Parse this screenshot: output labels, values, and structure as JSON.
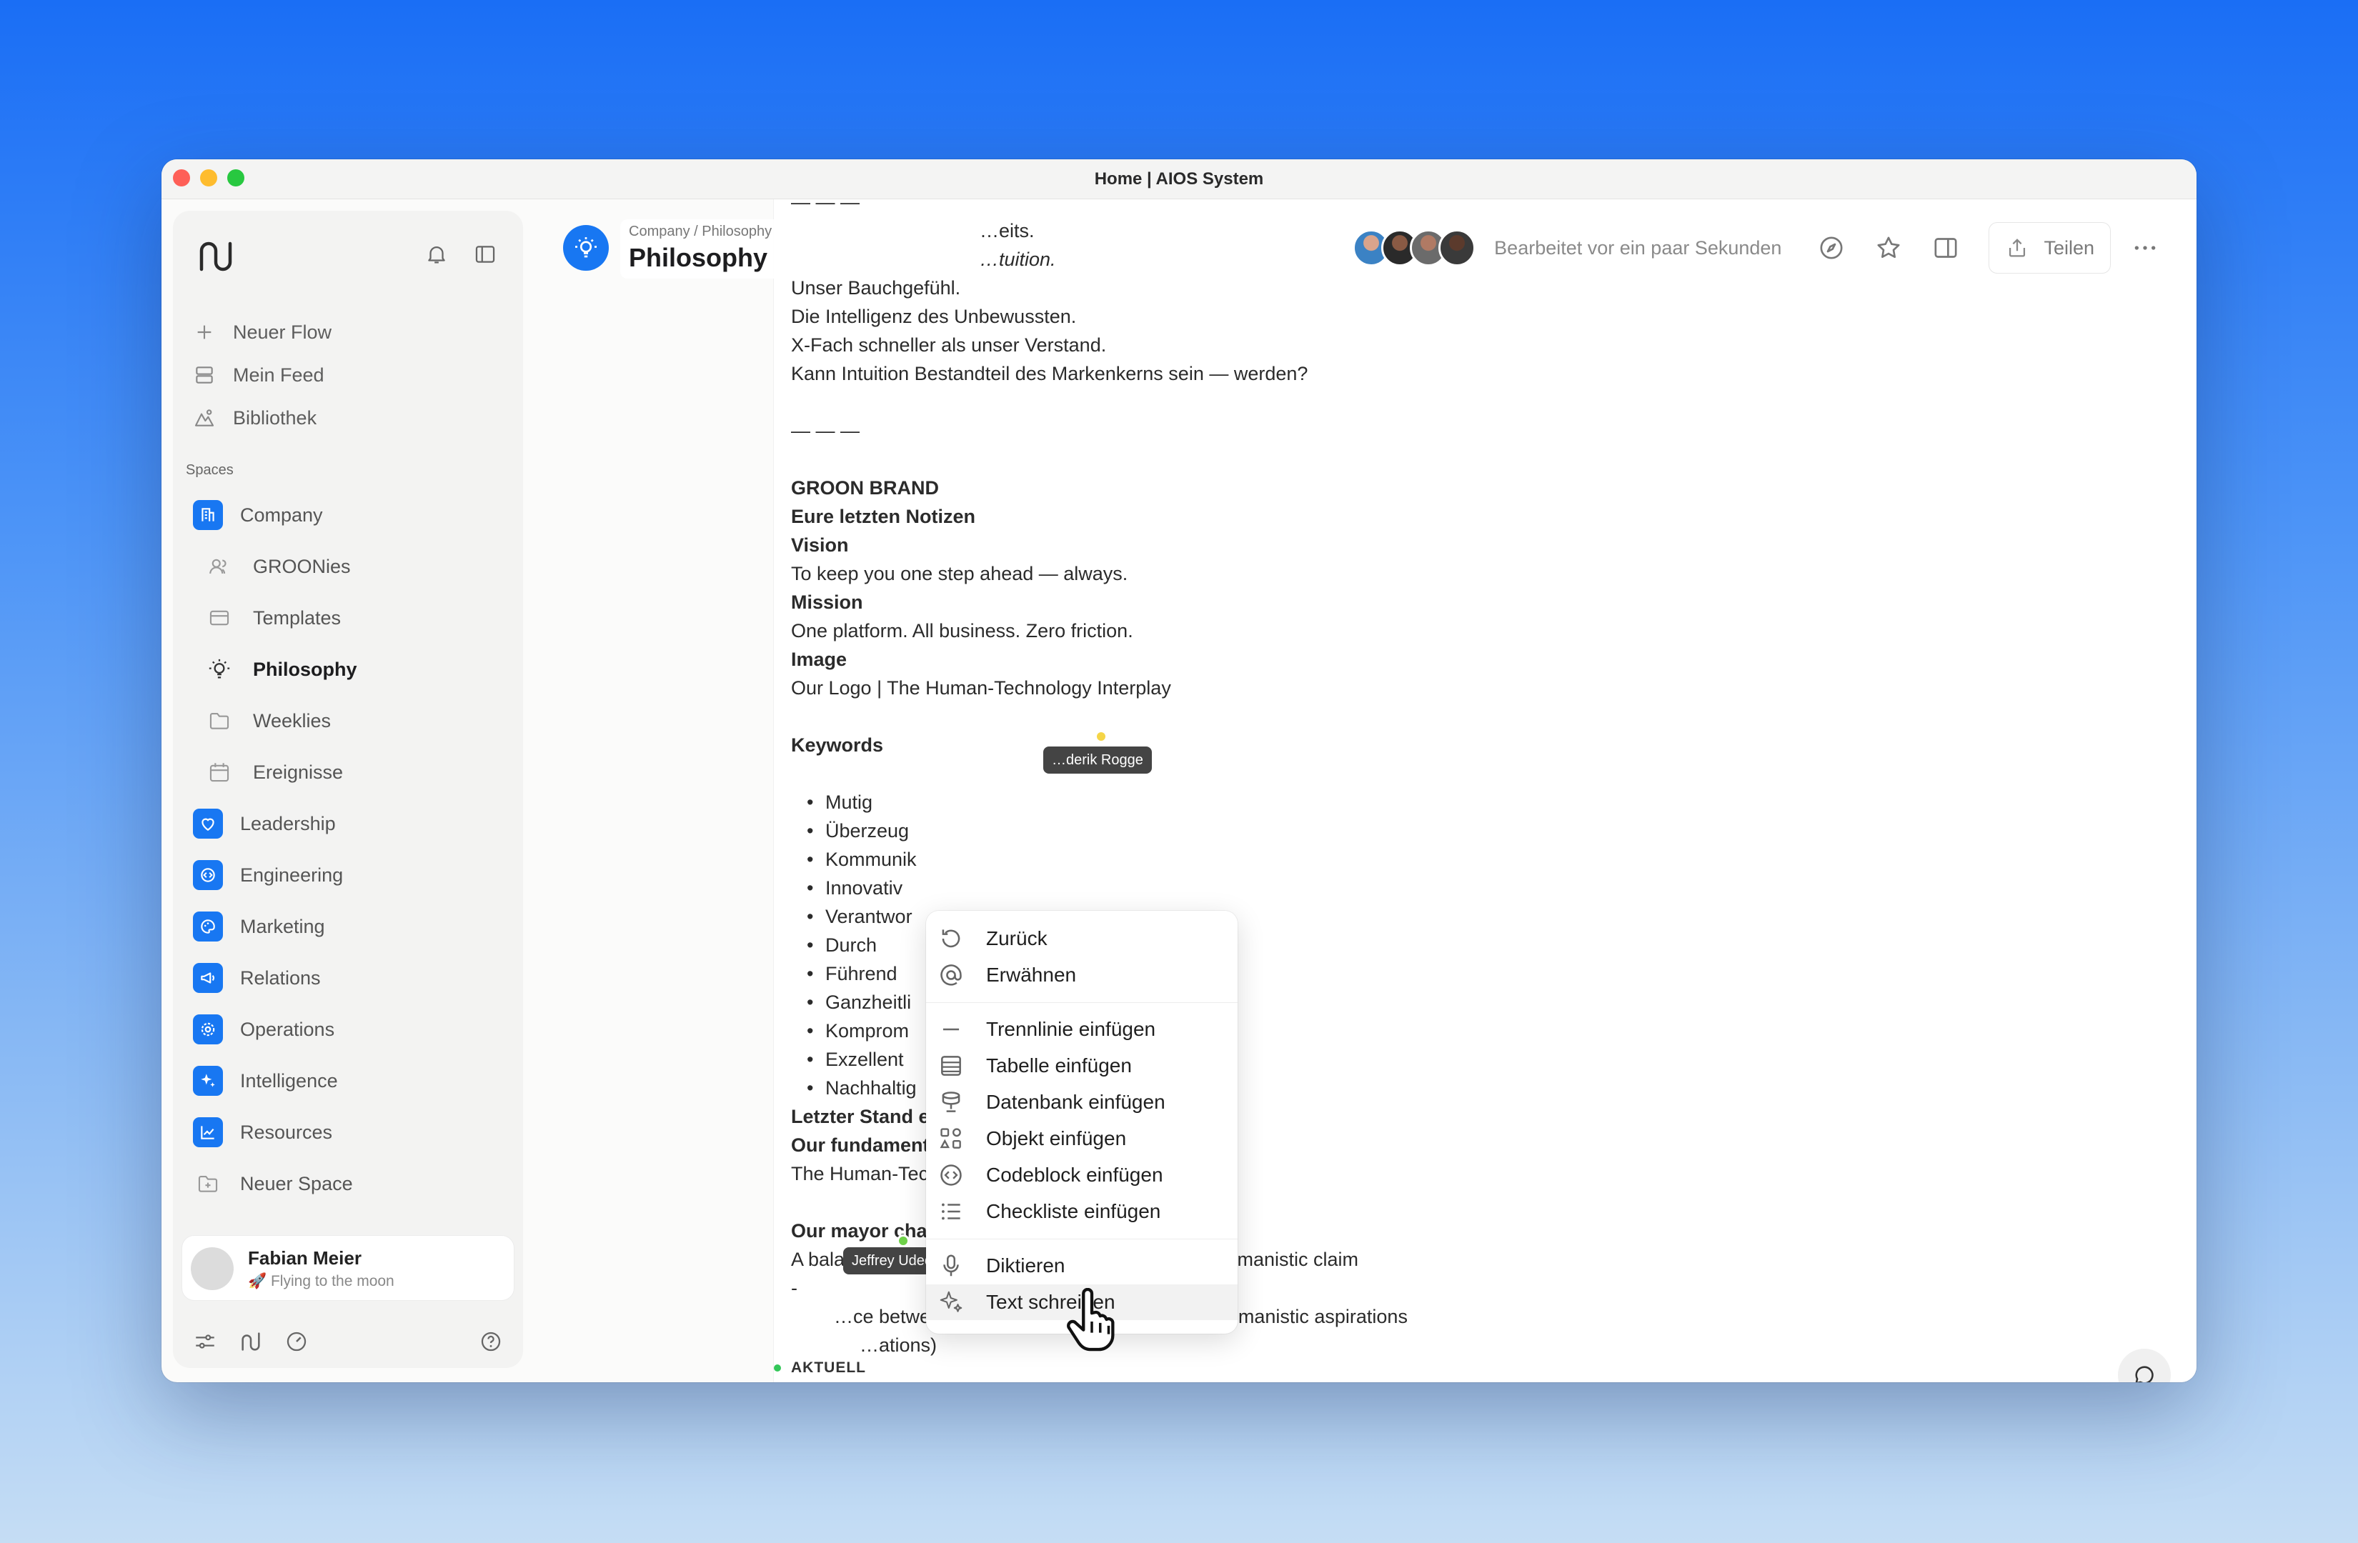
{
  "window": {
    "title": "Home | AIOS System"
  },
  "sidebar": {
    "nav": [
      {
        "label": "Neuer Flow"
      },
      {
        "label": "Mein Feed"
      },
      {
        "label": "Bibliothek"
      }
    ],
    "section_label": "Spaces",
    "spaces": [
      {
        "label": "Company"
      },
      {
        "label": "GROONies"
      },
      {
        "label": "Templates"
      },
      {
        "label": "Philosophy"
      },
      {
        "label": "Weeklies"
      },
      {
        "label": "Ereignisse"
      },
      {
        "label": "Leadership"
      },
      {
        "label": "Engineering"
      },
      {
        "label": "Marketing"
      },
      {
        "label": "Relations"
      },
      {
        "label": "Operations"
      },
      {
        "label": "Intelligence"
      },
      {
        "label": "Resources"
      },
      {
        "label": "Neuer Space"
      }
    ],
    "user": {
      "name": "Fabian Meier",
      "status": "🚀 Flying to the moon"
    },
    "accent": "#1877f2"
  },
  "header": {
    "breadcrumb": "Company  /  Philosophy",
    "title": "Philosophy",
    "edited": "Bearbeitet vor ein paar Sekunden",
    "share_label": "Teilen"
  },
  "doc": {
    "lines": [
      "— — —",
      "…eits.",
      "…tuition.",
      "Unser Bauchgefühl.",
      "Die Intelligenz des Unbewussten.",
      "X-Fach schneller als unser Verstand.",
      "Kann Intuition Bestandteil des Markenkerns sein — werden?",
      "",
      "— — —",
      "",
      "GROON BRAND",
      "Eure letzten Notizen",
      "Vision",
      "To keep you one step ahead — always.",
      "Mission",
      "One platform. All business. Zero friction.",
      "Image",
      "Our Logo | The Human-Technology Interplay",
      "",
      "Keywords",
      "",
      "Mutig",
      "Überzeug",
      "Kommunik",
      "Innovativ",
      "Verantwor",
      "Durch",
      "Führend",
      "Ganzheitli",
      "Komprom",
      "Exzellent",
      "Nachhaltig",
      "Letzter Stand e",
      "Our fundament",
      "The Human-Technology Interplay",
      "",
      "Our mayor challenge",
      "A balance between technological opportunity and humanistic claim",
      "-",
      "…ce between technological possibilities and humanistic aspirations",
      "…ations)"
    ],
    "status_label": "AKTUELL"
  },
  "menu": {
    "items": [
      {
        "label": "Zurück",
        "icon": "undo-icon"
      },
      {
        "label": "Erwähnen",
        "icon": "at-icon"
      },
      {
        "label": "Trennlinie einfügen",
        "icon": "divider-icon"
      },
      {
        "label": "Tabelle einfügen",
        "icon": "table-icon"
      },
      {
        "label": "Datenbank einfügen",
        "icon": "database-icon"
      },
      {
        "label": "Objekt einfügen",
        "icon": "object-icon"
      },
      {
        "label": "Codeblock einfügen",
        "icon": "code-icon"
      },
      {
        "label": "Checkliste einfügen",
        "icon": "checklist-icon"
      },
      {
        "label": "Diktieren",
        "icon": "microphone-icon"
      },
      {
        "label": "Text schreiben",
        "icon": "sparkle-icon"
      }
    ]
  },
  "collaborators": {
    "rogge": "…derik Rogge",
    "udeoha": "Jeffrey Udeoha",
    "rogge_color": "#f5d547",
    "udeoha_color": "#6fd24a"
  }
}
